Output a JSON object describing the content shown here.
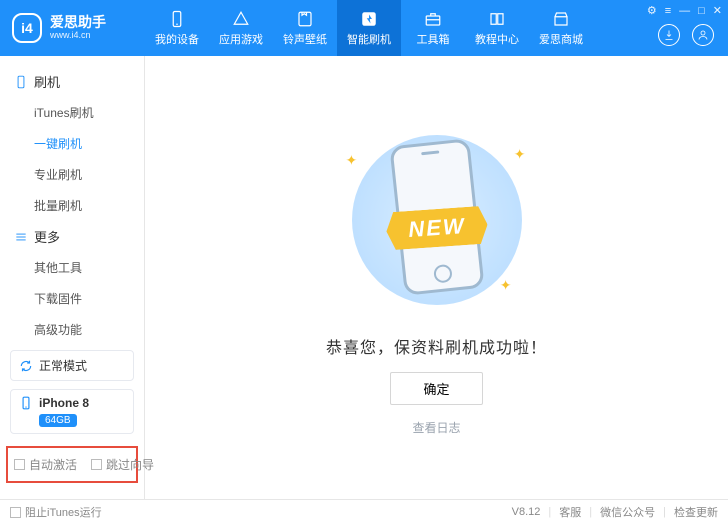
{
  "brand": {
    "logo_text": "i4",
    "title": "爱思助手",
    "subtitle": "www.i4.cn"
  },
  "topnav": [
    {
      "label": "我的设备",
      "icon": "phone-icon"
    },
    {
      "label": "应用游戏",
      "icon": "apps-icon"
    },
    {
      "label": "铃声壁纸",
      "icon": "music-icon"
    },
    {
      "label": "智能刷机",
      "icon": "flash-icon"
    },
    {
      "label": "工具箱",
      "icon": "toolbox-icon"
    },
    {
      "label": "教程中心",
      "icon": "book-icon"
    },
    {
      "label": "爱思商城",
      "icon": "store-icon"
    }
  ],
  "topnav_active_index": 3,
  "window_controls": {
    "settings": "⚙",
    "list": "≡",
    "min": "—",
    "max": "□",
    "close": "✕"
  },
  "header_icons": {
    "download": "download-icon",
    "user": "user-icon"
  },
  "sidebar": {
    "groups": [
      {
        "title": "刷机",
        "icon": "phone-outline-icon",
        "items": [
          "iTunes刷机",
          "一键刷机",
          "专业刷机",
          "批量刷机"
        ],
        "selected_index": 1
      },
      {
        "title": "更多",
        "icon": "menu-icon",
        "items": [
          "其他工具",
          "下载固件",
          "高级功能"
        ],
        "selected_index": -1
      }
    ],
    "status": {
      "label": "正常模式",
      "icon": "refresh-icon"
    },
    "device": {
      "name": "iPhone 8",
      "badge": "64GB",
      "icon": "phone-small-icon"
    },
    "bottom_options": [
      {
        "label": "自动激活",
        "checked": false
      },
      {
        "label": "跳过向导",
        "checked": false
      }
    ]
  },
  "main": {
    "ribbon_text": "NEW",
    "success_message": "恭喜您，保资料刷机成功啦！",
    "ok_button": "确定",
    "view_log": "查看日志"
  },
  "statusbar": {
    "block_itunes": "阻止iTunes运行",
    "version": "V8.12",
    "support": "客服",
    "wechat": "微信公众号",
    "update": "检查更新"
  }
}
